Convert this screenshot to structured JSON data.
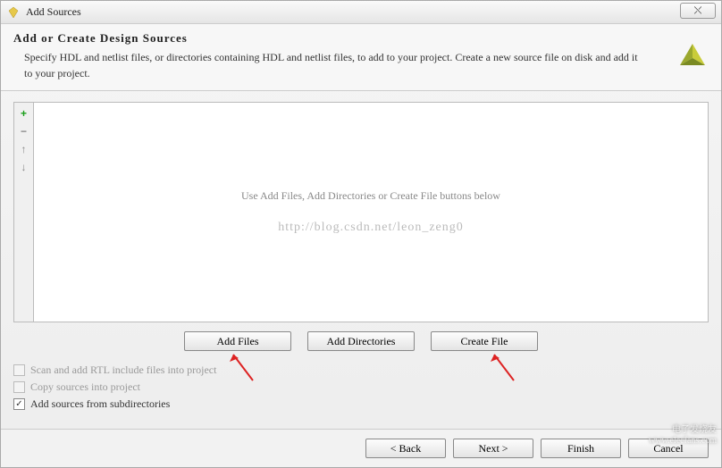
{
  "window": {
    "title": "Add Sources",
    "close_label": "✕"
  },
  "header": {
    "title": "Add or Create Design Sources",
    "description": "Specify HDL and netlist files, or directories containing HDL and netlist files, to add to your project. Create a new source file on disk and add it to your project."
  },
  "toolbar": {
    "add": "+",
    "remove": "−",
    "up": "↑",
    "down": "↓"
  },
  "listbox": {
    "placeholder": "Use Add Files, Add Directories or Create File buttons below",
    "watermark": "http://blog.csdn.net/leon_zeng0"
  },
  "buttons": {
    "add_files": "Add Files",
    "add_dirs": "Add Directories",
    "create_file": "Create File"
  },
  "checkboxes": {
    "scan_rtl": {
      "label": "Scan and add RTL include files into project",
      "checked": false,
      "enabled": false
    },
    "copy_sources": {
      "label": "Copy sources into project",
      "checked": false,
      "enabled": false
    },
    "add_subdirs": {
      "label": "Add sources from subdirectories",
      "checked": true,
      "enabled": true
    }
  },
  "footer": {
    "back": "< Back",
    "next": "Next >",
    "finish": "Finish",
    "cancel": "Cancel"
  },
  "corner_watermark": {
    "line1": "电子发烧友",
    "line2": "www.elecfans.com"
  }
}
